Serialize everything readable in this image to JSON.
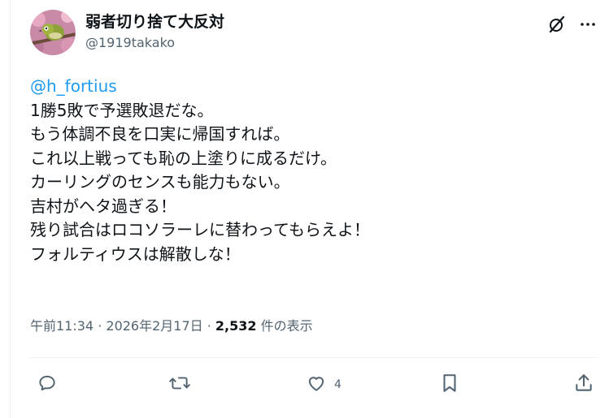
{
  "author": {
    "display_name": "弱者切り捨て大反対",
    "handle": "@1919takako"
  },
  "icons": {
    "grok": "grok-icon",
    "more": "more-dots-icon",
    "reply": "reply-icon",
    "repost": "repost-icon",
    "like": "like-icon",
    "bookmark": "bookmark-icon",
    "share": "share-icon"
  },
  "post": {
    "mention": "@h_fortius",
    "lines": [
      "1勝5敗で予選敗退だな。",
      "もう体調不良を口実に帰国すれば。",
      "これ以上戦っても恥の上塗りに成るだけ。",
      "カーリングのセンスも能力もない。",
      "吉村がヘタ過ぎる！",
      "残り試合はロコソラーレに替わってもらえよ！",
      "フォルティウスは解散しな！"
    ]
  },
  "meta": {
    "time": "午前11:34",
    "separator": " · ",
    "date": "2026年2月17日",
    "separator2": " · ",
    "views": "2,532",
    "views_label": " 件の表示"
  },
  "actions": {
    "like_count": "4"
  },
  "colors": {
    "link": "#1d9bf0",
    "text": "#0f1419",
    "muted": "#536471",
    "border": "#eff3f4"
  }
}
